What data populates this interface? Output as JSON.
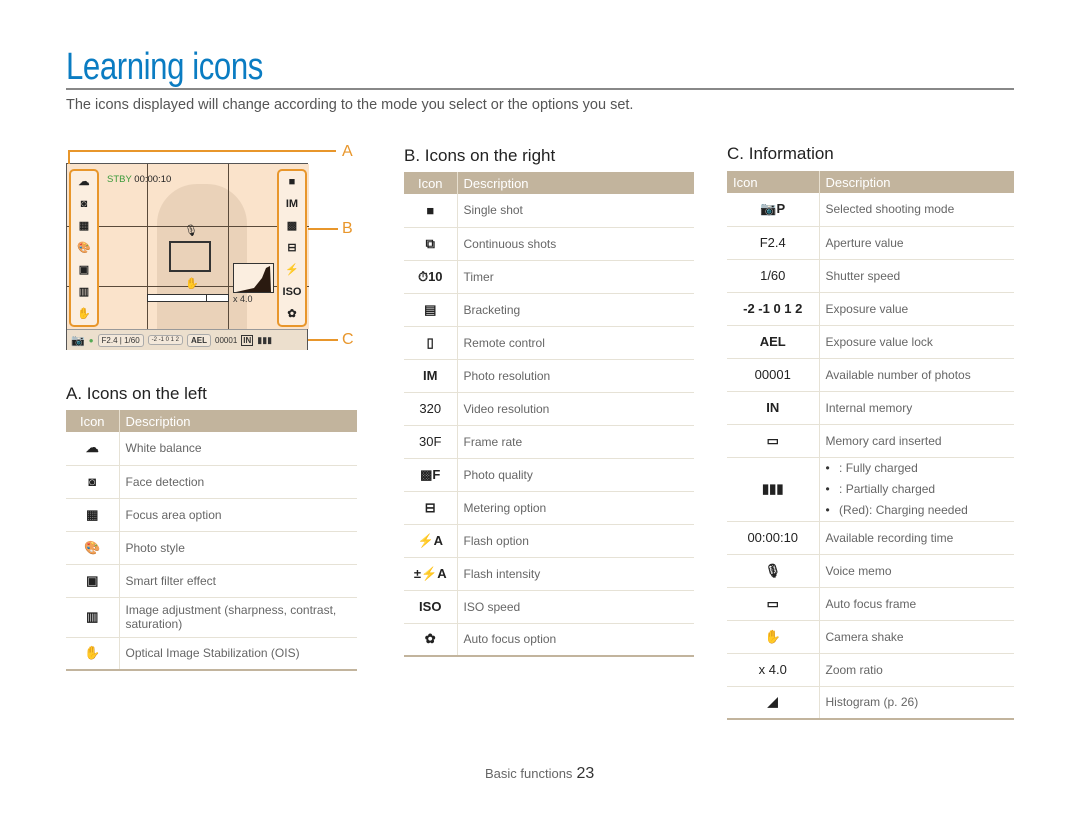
{
  "page": {
    "title": "Learning icons",
    "subtitle": "The icons displayed will change according to the mode you select or the options you set."
  },
  "screen": {
    "stby_label": "STBY",
    "rec_time": "00:00:10",
    "zoom_ratio": "x 4.0",
    "aperture": "F2.4",
    "shutter": "1/60",
    "ael": "AEL",
    "photo_count": "00001",
    "memory": "IN",
    "callouts": [
      "A",
      "B",
      "C"
    ],
    "left_icons": [
      "☁",
      "◙",
      "▦",
      "🎨",
      "▣",
      "▥",
      "✋"
    ],
    "right_icons": [
      "■",
      "IM",
      "▩",
      "⊟",
      "⚡",
      "ISO",
      "✿"
    ]
  },
  "sectionA": {
    "heading": "A. Icons on the left",
    "col_icon": "Icon",
    "col_desc": "Description",
    "rows": [
      {
        "icon": "white-balance-icon",
        "glyph": "☁",
        "desc": "White balance"
      },
      {
        "icon": "face-detection-icon",
        "glyph": "◙",
        "desc": "Face detection"
      },
      {
        "icon": "focus-area-icon",
        "glyph": "▦",
        "desc": "Focus area option"
      },
      {
        "icon": "photo-style-icon",
        "glyph": "🎨",
        "desc": "Photo style"
      },
      {
        "icon": "smart-filter-icon",
        "glyph": "▣",
        "desc": "Smart filter effect"
      },
      {
        "icon": "image-adjustment-icon",
        "glyph": "▥",
        "desc": "Image adjustment (sharpness, contrast, saturation)"
      },
      {
        "icon": "ois-icon",
        "glyph": "✋",
        "desc": "Optical Image Stabilization (OIS)"
      }
    ]
  },
  "sectionB": {
    "heading": "B. Icons on the right",
    "col_icon": "Icon",
    "col_desc": "Description",
    "rows": [
      {
        "icon": "single-shot-icon",
        "glyph": "■",
        "desc": "Single shot"
      },
      {
        "icon": "continuous-shots-icon",
        "glyph": "⧉",
        "desc": "Continuous shots"
      },
      {
        "icon": "timer-icon",
        "glyph": "⏱10",
        "desc": "Timer"
      },
      {
        "icon": "bracketing-icon",
        "glyph": "▤",
        "desc": "Bracketing"
      },
      {
        "icon": "remote-control-icon",
        "glyph": "▯",
        "desc": "Remote control"
      },
      {
        "icon": "photo-resolution-icon",
        "glyph": "IM",
        "desc": "Photo resolution"
      },
      {
        "icon": "video-resolution-icon",
        "glyph": "320",
        "desc": "Video resolution"
      },
      {
        "icon": "frame-rate-icon",
        "glyph": "30F",
        "desc": "Frame rate"
      },
      {
        "icon": "photo-quality-icon",
        "glyph": "▩F",
        "desc": "Photo quality"
      },
      {
        "icon": "metering-icon",
        "glyph": "⊟",
        "desc": "Metering option"
      },
      {
        "icon": "flash-icon",
        "glyph": "⚡A",
        "desc": "Flash option"
      },
      {
        "icon": "flash-intensity-icon",
        "glyph": "±⚡A",
        "desc": "Flash intensity"
      },
      {
        "icon": "iso-icon",
        "glyph": "ISO",
        "desc": "ISO speed"
      },
      {
        "icon": "auto-focus-icon",
        "glyph": "✿",
        "desc": "Auto focus option"
      }
    ]
  },
  "sectionC": {
    "heading": "C. Information",
    "col_icon": "Icon",
    "col_desc": "Description",
    "rows": [
      {
        "icon": "shooting-mode-icon",
        "glyph": "📷P",
        "desc": "Selected shooting mode"
      },
      {
        "icon": "aperture-text",
        "glyph": "F2.4",
        "desc": "Aperture value"
      },
      {
        "icon": "shutter-text",
        "glyph": "1/60",
        "desc": "Shutter speed"
      },
      {
        "icon": "exposure-scale-icon",
        "glyph": "-2 -1 0 1 2",
        "desc": "Exposure value"
      },
      {
        "icon": "ael-icon",
        "glyph": "AEL",
        "desc": "Exposure value lock"
      },
      {
        "icon": "photo-count-text",
        "glyph": "00001",
        "desc": "Available number of photos"
      },
      {
        "icon": "internal-memory-icon",
        "glyph": "IN",
        "desc": "Internal memory"
      },
      {
        "icon": "memory-card-icon",
        "glyph": "▭",
        "desc": "Memory card inserted"
      },
      {
        "icon": "battery-icon",
        "glyph": "▮▮▮",
        "bullets": [
          ": Fully charged",
          ": Partially charged",
          "(Red): Charging needed"
        ]
      },
      {
        "icon": "recording-time-text",
        "glyph": "00:00:10",
        "desc": "Available recording time"
      },
      {
        "icon": "voice-memo-icon",
        "glyph": "🎙",
        "desc": "Voice memo"
      },
      {
        "icon": "af-frame-icon",
        "glyph": "▭",
        "desc": "Auto focus frame"
      },
      {
        "icon": "camera-shake-icon",
        "glyph": "✋",
        "desc": "Camera shake"
      },
      {
        "icon": "zoom-ratio-icon",
        "glyph": "x 4.0",
        "desc": "Zoom ratio"
      },
      {
        "icon": "histogram-icon",
        "glyph": "◢",
        "desc": "Histogram (p. 26)"
      }
    ]
  },
  "footer": {
    "section": "Basic functions",
    "page": "23"
  }
}
